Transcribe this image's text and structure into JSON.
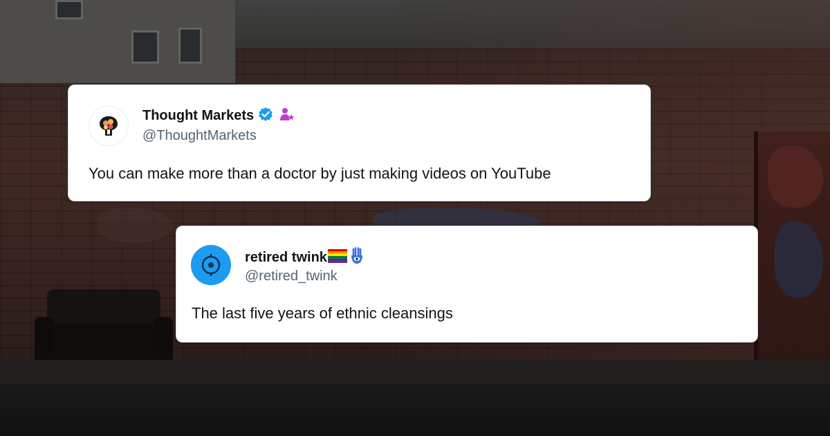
{
  "tweets": [
    {
      "display_name": "Thought Markets",
      "handle": "@ThoughtMarkets",
      "text": "You can make more than a doctor by just making videos on YouTube",
      "verified": true,
      "avatar_icon": "brain-keyhole-logo-icon",
      "badges": [
        "verified-badge-icon",
        "person-star-icon"
      ],
      "colors": {
        "verified": "#1d9bf0",
        "person_star": "#c13cc8"
      }
    },
    {
      "display_name": "retired twink",
      "handle": "@retired_twink",
      "text": "The last five years of ethnic cleansings",
      "verified": false,
      "avatar_icon": "target-circle-avatar-icon",
      "badges": [
        "rainbow-flag-icon",
        "hamsa-hand-icon"
      ],
      "colors": {
        "avatar_bg": "#1d9bf0"
      }
    }
  ],
  "theme": {
    "card_bg": "#ffffff",
    "name_color": "#0f1419",
    "handle_color": "#536471",
    "text_color": "#0f1419"
  }
}
